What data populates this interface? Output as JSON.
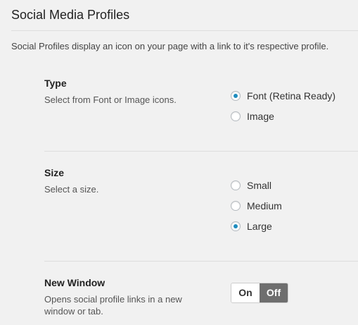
{
  "section": {
    "title": "Social Media Profiles",
    "description": "Social Profiles display an icon on your page with a link to it's respective profile."
  },
  "type_option": {
    "label": "Type",
    "help": "Select from Font or Image icons.",
    "choices": [
      {
        "label": "Font (Retina Ready)",
        "checked": true
      },
      {
        "label": "Image",
        "checked": false
      }
    ]
  },
  "size_option": {
    "label": "Size",
    "help": "Select a size.",
    "choices": [
      {
        "label": "Small",
        "checked": false
      },
      {
        "label": "Medium",
        "checked": false
      },
      {
        "label": "Large",
        "checked": true
      }
    ]
  },
  "new_window_option": {
    "label": "New Window",
    "help": "Opens social profile links in a new window or tab.",
    "toggle": {
      "on_label": "On",
      "off_label": "Off",
      "selected": "Off"
    }
  },
  "colors": {
    "accent": "#1e8cbe",
    "toggle_selected": "#6e6e6e",
    "background": "#f1f1f1"
  }
}
